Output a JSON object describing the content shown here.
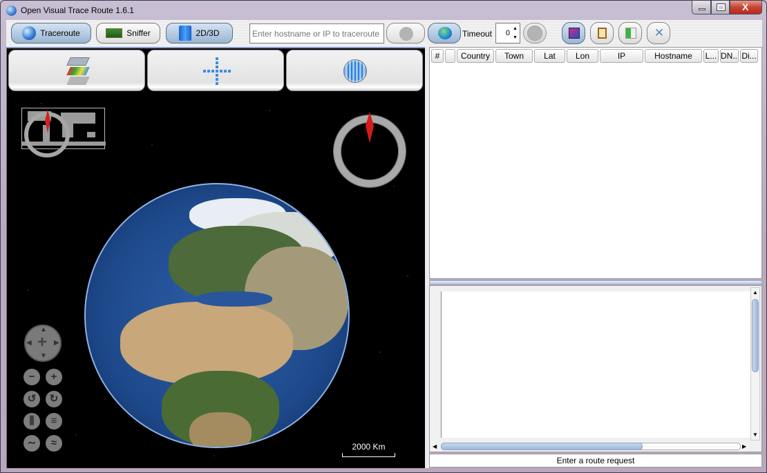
{
  "window": {
    "title": "Open Visual Trace Route 1.6.1",
    "app_icon": "globe-icon",
    "controls": {
      "minimize": "minimize-icon",
      "maximize": "maximize-icon",
      "close": "close-icon",
      "close_glyph": "X"
    }
  },
  "toolbar": {
    "mode_buttons": [
      {
        "label": "Traceroute",
        "icon": "globe-icon",
        "active": true
      },
      {
        "label": "Sniffer",
        "icon": "network-card-icon",
        "active": false
      },
      {
        "label": "2D/3D",
        "icon": "cube-icon",
        "active": false
      }
    ],
    "host_input": {
      "value": "",
      "placeholder": "Enter hostname or IP to traceroute"
    },
    "network_interface_icon": "network-computer-icon",
    "timeout_label": "Timeout",
    "timeout_value": "0",
    "right_buttons": [
      {
        "name": "map-settings",
        "icon": "map-icon",
        "active": true
      },
      {
        "name": "clipboard",
        "icon": "clipboard-icon",
        "active": false
      },
      {
        "name": "export",
        "icon": "export-document-icon",
        "active": false
      },
      {
        "name": "settings",
        "icon": "tools-icon",
        "active": false
      }
    ]
  },
  "map": {
    "view_buttons": [
      {
        "name": "layers",
        "icon": "layers-icon"
      },
      {
        "name": "flat-projection",
        "icon": "crosshair-icon"
      },
      {
        "name": "globe-projection",
        "icon": "wireframe-globe-icon"
      }
    ],
    "scale_label": "2000 Km",
    "zoom_controls": [
      {
        "name": "zoom-out",
        "glyph": "−"
      },
      {
        "name": "zoom-in",
        "glyph": "+"
      },
      {
        "name": "rotate-left",
        "glyph": "↺"
      },
      {
        "name": "rotate-right",
        "glyph": "↻"
      },
      {
        "name": "tilt-up",
        "glyph": "⫼"
      },
      {
        "name": "tilt-down",
        "glyph": "≡"
      },
      {
        "name": "elevation-flat",
        "glyph": "∼"
      },
      {
        "name": "elevation-exaggerate",
        "glyph": "≈"
      }
    ]
  },
  "route_table": {
    "columns": [
      "#",
      "",
      "Country",
      "Town",
      "Lat",
      "Lon",
      "IP",
      "Hostname",
      "L...",
      "DN...",
      "Di..."
    ],
    "rows": []
  },
  "log": {
    "text": ""
  },
  "status": "Enter a route request"
}
